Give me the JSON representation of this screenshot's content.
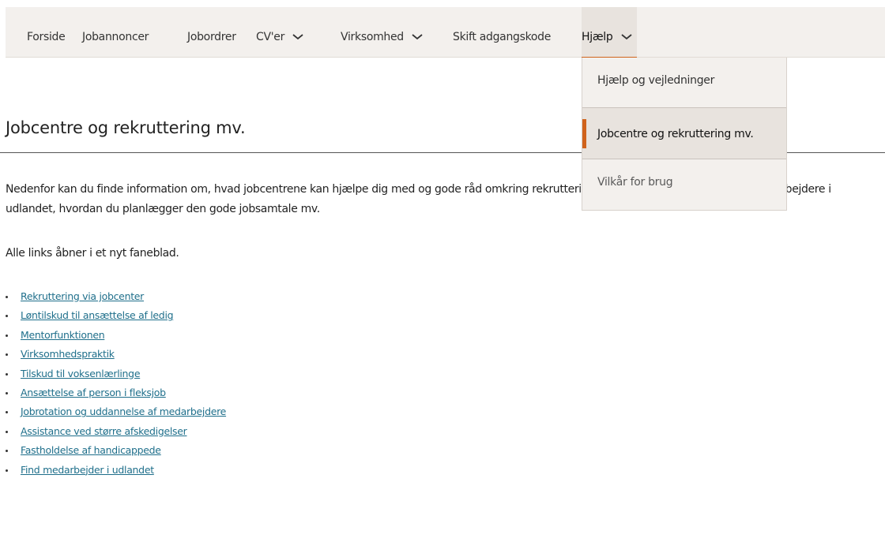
{
  "nav": {
    "items": [
      {
        "label": "Forside"
      },
      {
        "label": "Jobannoncer"
      },
      {
        "label": "Jobordrer"
      },
      {
        "label": "CV'er",
        "has_dropdown": true
      },
      {
        "label": "Virksomhed",
        "has_dropdown": true
      },
      {
        "label": "Skift adgangskode"
      },
      {
        "label": "Hjælp",
        "has_dropdown": true,
        "active": true
      }
    ],
    "chevron_icon": "chevron-down-icon",
    "accent_color": "#d0631c"
  },
  "dropdown": {
    "items": [
      {
        "label": "Hjælp og vejledninger"
      },
      {
        "label": "Jobcentre og rekruttering mv.",
        "selected": true
      },
      {
        "label": "Vilkår for brug"
      }
    ]
  },
  "page": {
    "title": "Jobcentre og rekruttering mv.",
    "intro": "Nedenfor kan du finde information om, hvad jobcentrene kan hjælpe dig med og gode råd omkring rekruttering, herunder hvordan du finder medarbejdere i udlandet, hvordan du planlægger den gode jobsamtale mv.",
    "note": "Alle links åbner i et nyt faneblad.",
    "link_color": "#1f6f8b",
    "links": [
      "Rekruttering via jobcenter",
      "Løntilskud til ansættelse af ledig",
      "Mentorfunktionen",
      "Virksomhedspraktik",
      "Tilskud til voksenlærlinge",
      "Ansættelse af person i fleksjob",
      "Jobrotation og uddannelse af medarbejdere",
      "Assistance ved større afskedigelser",
      "Fastholdelse af handicappede",
      "Find medarbejder i udlandet"
    ]
  }
}
